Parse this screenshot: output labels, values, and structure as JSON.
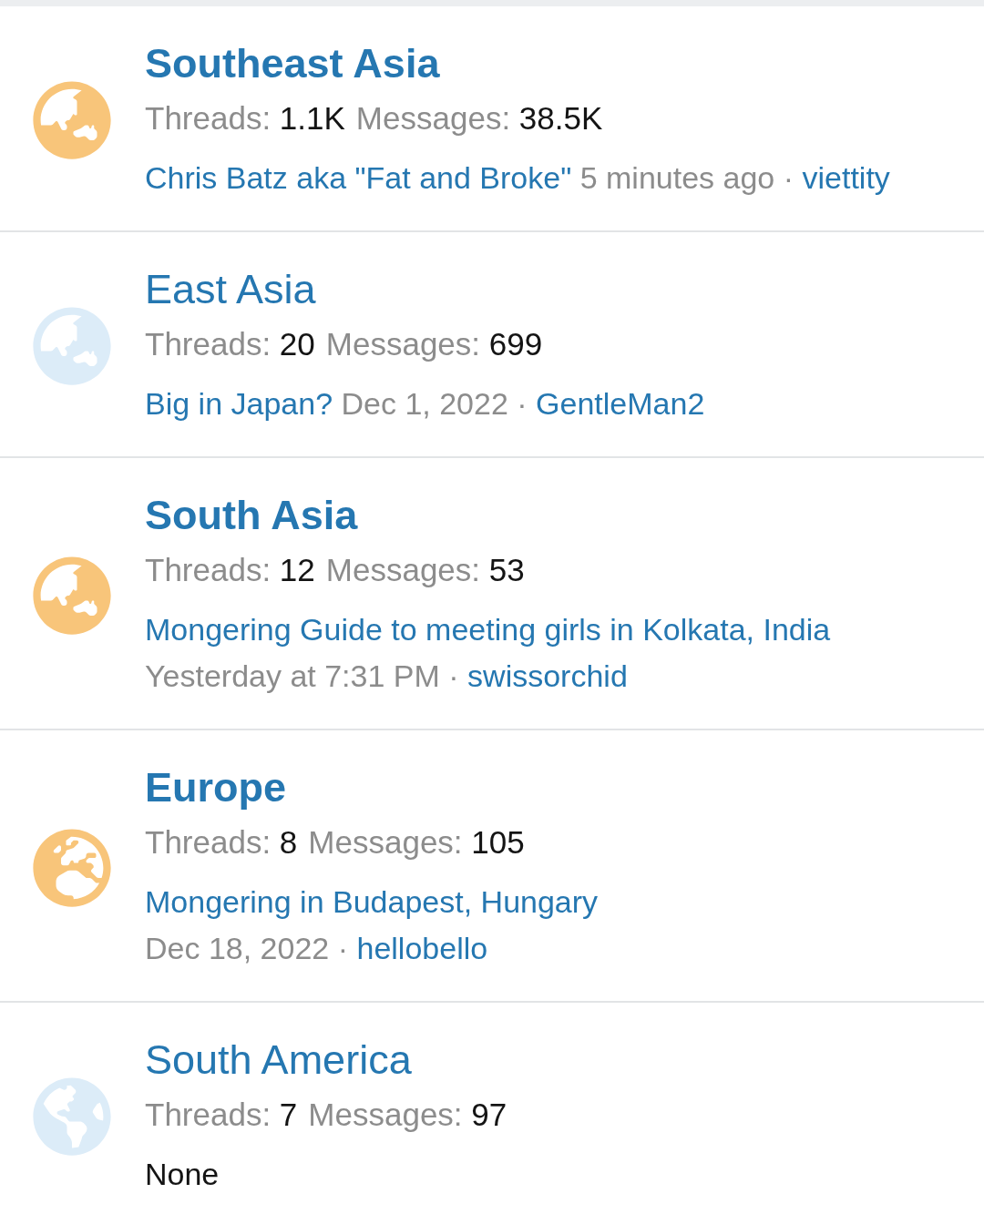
{
  "forums": [
    {
      "title": "Southeast Asia",
      "unread": true,
      "kind": "asia",
      "threads_label": "Threads:",
      "threads": "1.1K",
      "messages_label": "Messages:",
      "messages": "38.5K",
      "last_post": {
        "kind": "post",
        "thread": "Chris Batz aka \"Fat and Broke\"",
        "date": "5 minutes ago",
        "separator": "·",
        "user": "viettity"
      }
    },
    {
      "title": "East Asia",
      "unread": false,
      "kind": "asia",
      "threads_label": "Threads:",
      "threads": "20",
      "messages_label": "Messages:",
      "messages": "699",
      "last_post": {
        "kind": "post",
        "thread": "Big in Japan?",
        "date": "Dec 1, 2022",
        "separator": "·",
        "user": "GentleMan2"
      }
    },
    {
      "title": "South Asia",
      "unread": true,
      "kind": "asia",
      "threads_label": "Threads:",
      "threads": "12",
      "messages_label": "Messages:",
      "messages": "53",
      "last_post": {
        "kind": "post",
        "thread": "Mongering Guide to meeting girls in Kolkata, India",
        "date": "Yesterday at 7:31 PM",
        "separator": "·",
        "user": "swissorchid"
      }
    },
    {
      "title": "Europe",
      "unread": true,
      "kind": "europe",
      "threads_label": "Threads:",
      "threads": "8",
      "messages_label": "Messages:",
      "messages": "105",
      "last_post": {
        "kind": "post",
        "thread": "Mongering in Budapest, Hungary",
        "date": "Dec 18, 2022",
        "separator": "·",
        "user": "hellobello"
      }
    },
    {
      "title": "South America",
      "unread": false,
      "kind": "americas",
      "threads_label": "Threads:",
      "threads": "7",
      "messages_label": "Messages:",
      "messages": "97",
      "last_post": {
        "kind": "none",
        "text": "None"
      }
    }
  ]
}
